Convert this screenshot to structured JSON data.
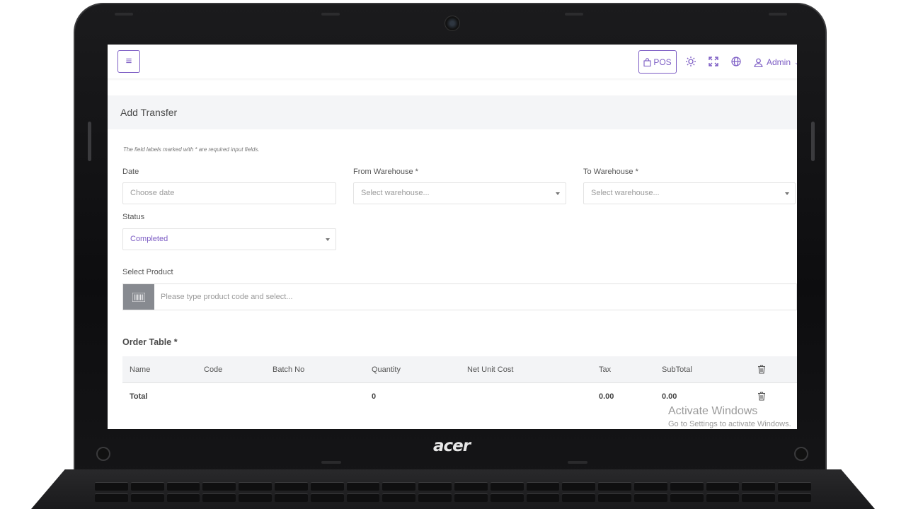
{
  "topbar": {
    "menu_icon": "hamburger-icon",
    "pos_label": "POS",
    "pos_icon": "shopping-bag-icon",
    "theme_icon": "sun-icon",
    "fullscreen_icon": "expand-icon",
    "language_icon": "globe-icon",
    "user_label": "Admin",
    "user_icon": "user-icon"
  },
  "page": {
    "title": "Add Transfer",
    "note": "The field labels marked with * are required input fields."
  },
  "form": {
    "date_label": "Date",
    "date_placeholder": "Choose date",
    "from_label": "From Warehouse *",
    "from_placeholder": "Select warehouse...",
    "to_label": "To Warehouse *",
    "to_placeholder": "Select warehouse...",
    "status_label": "Status",
    "status_value": "Completed",
    "product_label": "Select Product",
    "product_placeholder": "Please type product code and select...",
    "barcode_icon": "barcode-icon"
  },
  "order_table": {
    "title": "Order Table *",
    "columns": [
      "Name",
      "Code",
      "Batch No",
      "Quantity",
      "Net Unit Cost",
      "Tax",
      "SubTotal"
    ],
    "total_row": {
      "label": "Total",
      "quantity": "0",
      "tax": "0.00",
      "subtotal": "0.00"
    },
    "delete_icon": "trash-icon"
  },
  "watermark": {
    "title": "Activate Windows",
    "subtitle": "Go to Settings to activate Windows."
  },
  "device": {
    "brand": "acer"
  },
  "colors": {
    "accent": "#7c5cc4",
    "barcode_button": "#878a90",
    "header_bg": "#f4f5f7"
  }
}
